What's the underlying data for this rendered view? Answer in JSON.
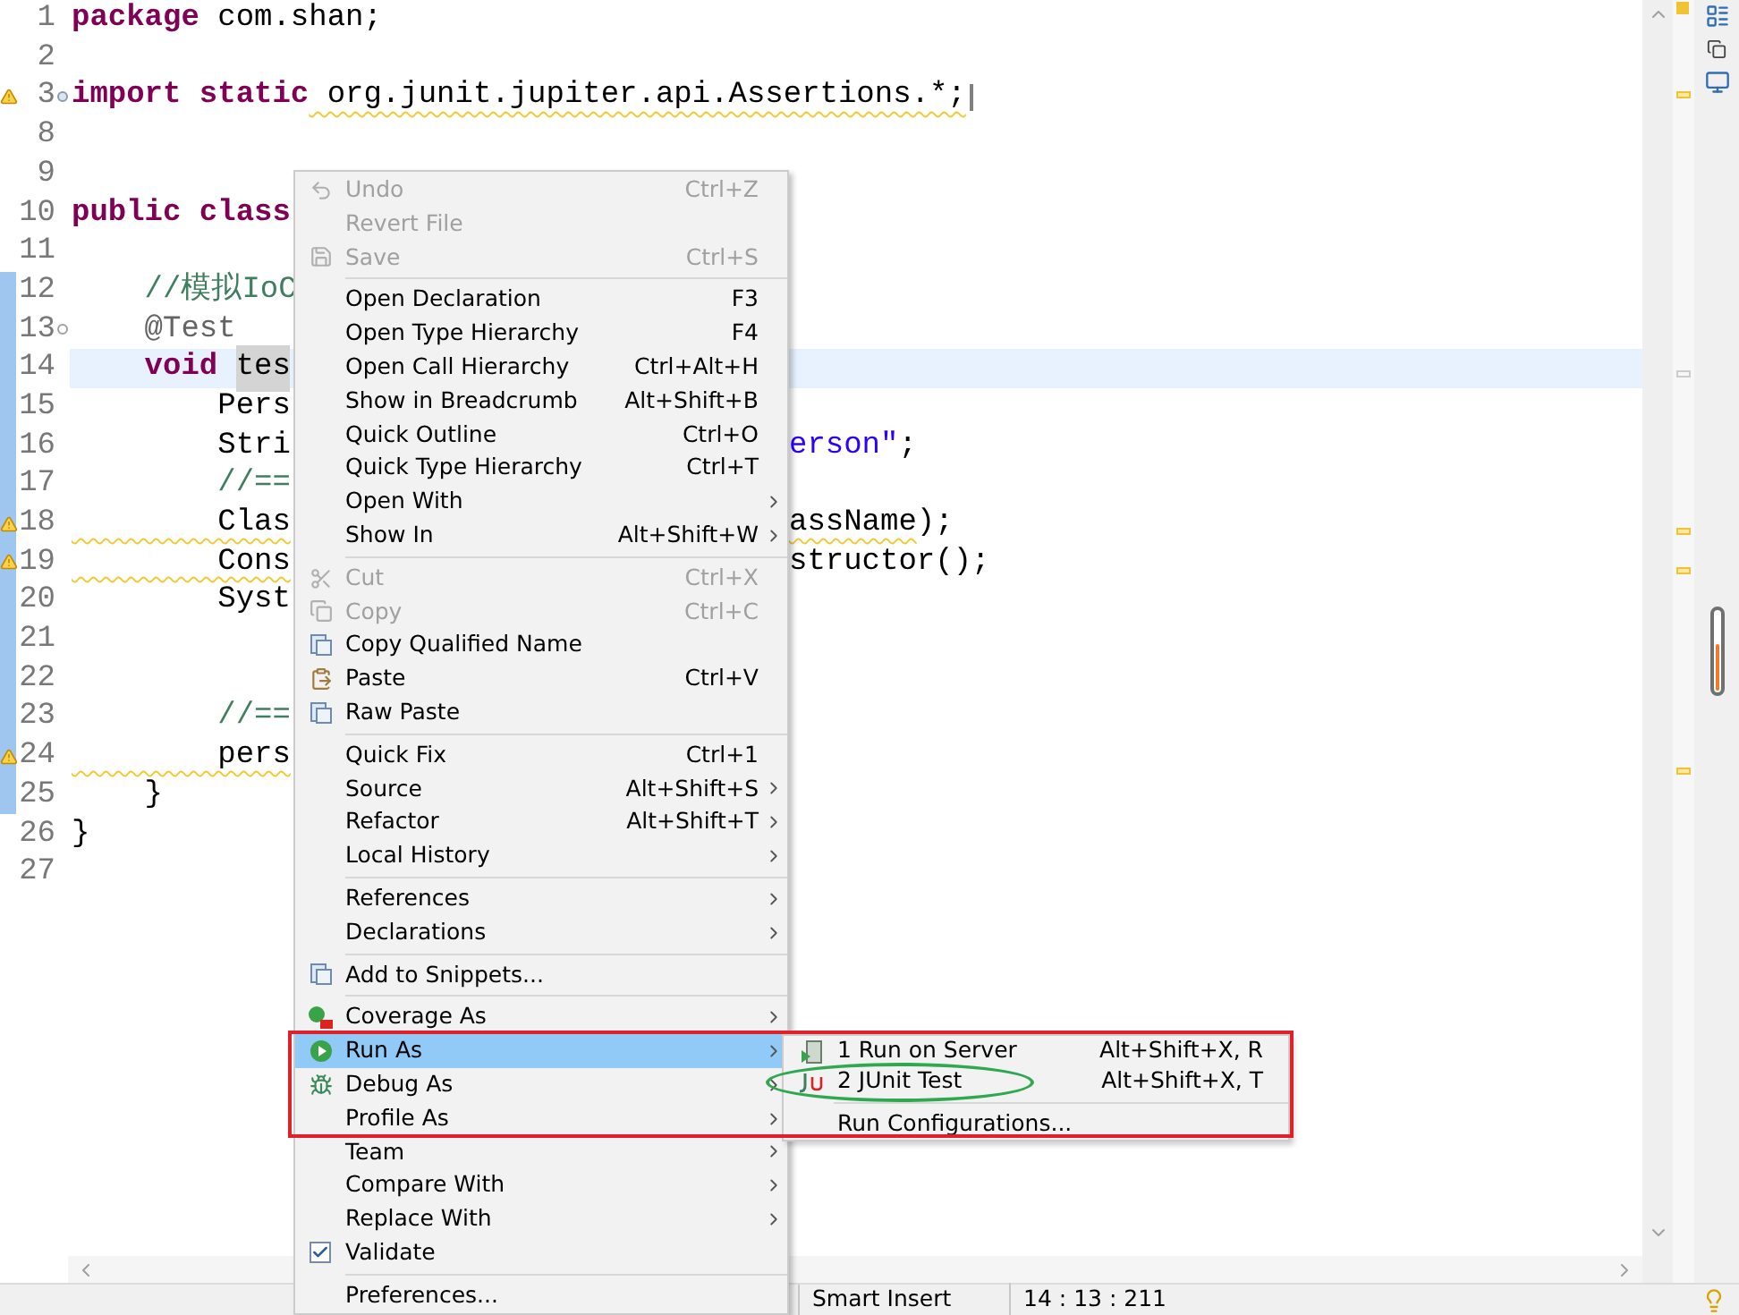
{
  "editor": {
    "lines": [
      {
        "number": "1",
        "warning": false,
        "changed": false,
        "current": false,
        "tokens": [
          {
            "kind": "keyword",
            "text": "package"
          },
          {
            "kind": "plain",
            "text": " com.shan;"
          }
        ]
      },
      {
        "number": "2",
        "warning": false,
        "changed": false,
        "current": false
      },
      {
        "number": "3",
        "warning": true,
        "changed": false,
        "current": false,
        "folded": true,
        "tokens": [
          {
            "kind": "keyword",
            "text": "import static"
          },
          {
            "kind": "flagged",
            "text": " org.junit.jupiter.api.Assertions.*;"
          }
        ],
        "folded_box": true
      },
      {
        "number": "8",
        "warning": false,
        "changed": false,
        "current": false
      },
      {
        "number": "9",
        "warning": false,
        "changed": false,
        "current": false
      },
      {
        "number": "10",
        "warning": false,
        "changed": false,
        "current": false,
        "tokens": [
          {
            "kind": "keyword",
            "text": "public class"
          }
        ]
      },
      {
        "number": "11",
        "warning": false,
        "changed": false,
        "current": false
      },
      {
        "number": "12",
        "warning": false,
        "changed": true,
        "current": false,
        "tokens": [
          {
            "kind": "comment",
            "text": "    //模拟IoC"
          }
        ]
      },
      {
        "number": "13",
        "warning": false,
        "changed": true,
        "current": false,
        "folded": false,
        "tokens": [
          {
            "kind": "annotation",
            "text": "    @Test"
          }
        ]
      },
      {
        "number": "14",
        "warning": false,
        "changed": true,
        "current": true,
        "tokens": [
          {
            "kind": "keyword",
            "text": "    void "
          },
          {
            "kind": "selection",
            "text": "tes"
          }
        ]
      },
      {
        "number": "15",
        "warning": false,
        "changed": true,
        "current": false,
        "tokens": [
          {
            "kind": "plain",
            "text": "        Pers"
          }
        ]
      },
      {
        "number": "16",
        "warning": false,
        "changed": true,
        "current": false,
        "tokens": [
          {
            "kind": "plain",
            "text": "        Stri"
          }
        ],
        "tail": [
          {
            "kind": "string",
            "text": "erson\""
          },
          {
            "kind": "plain",
            "text": ";"
          }
        ]
      },
      {
        "number": "17",
        "warning": false,
        "changed": true,
        "current": false,
        "tokens": [
          {
            "kind": "comment",
            "text": "        //=="
          }
        ]
      },
      {
        "number": "18",
        "warning": true,
        "changed": true,
        "current": false,
        "tokens": [
          {
            "kind": "flagged",
            "text": "        Clas"
          }
        ],
        "tail": [
          {
            "kind": "flagged",
            "text": "assName"
          },
          {
            "kind": "plain",
            "text": ");"
          }
        ]
      },
      {
        "number": "19",
        "warning": true,
        "changed": true,
        "current": false,
        "tokens": [
          {
            "kind": "flagged",
            "text": "        Cons"
          }
        ],
        "tail": [
          {
            "kind": "plain",
            "text": "structor();"
          }
        ]
      },
      {
        "number": "20",
        "warning": false,
        "changed": true,
        "current": false,
        "tokens": [
          {
            "kind": "plain",
            "text": "        Syst"
          }
        ]
      },
      {
        "number": "21",
        "warning": false,
        "changed": true,
        "current": false
      },
      {
        "number": "22",
        "warning": false,
        "changed": true,
        "current": false
      },
      {
        "number": "23",
        "warning": false,
        "changed": true,
        "current": false,
        "tokens": [
          {
            "kind": "comment",
            "text": "        //=="
          }
        ]
      },
      {
        "number": "24",
        "warning": true,
        "changed": true,
        "current": false,
        "tokens": [
          {
            "kind": "flagged",
            "text": "        pers"
          }
        ]
      },
      {
        "number": "25",
        "warning": false,
        "changed": true,
        "current": false,
        "tokens": [
          {
            "kind": "plain",
            "text": "    }"
          }
        ]
      },
      {
        "number": "26",
        "warning": false,
        "changed": false,
        "current": false,
        "tokens": [
          {
            "kind": "plain",
            "text": "}"
          }
        ]
      },
      {
        "number": "27",
        "warning": false,
        "changed": false,
        "current": false
      }
    ]
  },
  "context_menu": {
    "items": [
      {
        "kind": "item",
        "label": "Undo",
        "shortcut": "Ctrl+Z",
        "disabled": true,
        "submenu": false,
        "selected": false
      },
      {
        "kind": "item",
        "label": "Revert File",
        "disabled": true,
        "submenu": false,
        "selected": false
      },
      {
        "kind": "item",
        "label": "Save",
        "shortcut": "Ctrl+S",
        "disabled": true,
        "submenu": false,
        "selected": false
      },
      {
        "kind": "separator"
      },
      {
        "kind": "item",
        "label": "Open Declaration",
        "shortcut": "F3",
        "disabled": false,
        "submenu": false,
        "selected": false
      },
      {
        "kind": "item",
        "label": "Open Type Hierarchy",
        "shortcut": "F4",
        "disabled": false,
        "submenu": false,
        "selected": false
      },
      {
        "kind": "item",
        "label": "Open Call Hierarchy",
        "shortcut": "Ctrl+Alt+H",
        "disabled": false,
        "submenu": false,
        "selected": false
      },
      {
        "kind": "item",
        "label": "Show in Breadcrumb",
        "shortcut": "Alt+Shift+B",
        "disabled": false,
        "submenu": false,
        "selected": false
      },
      {
        "kind": "item",
        "label": "Quick Outline",
        "shortcut": "Ctrl+O",
        "disabled": false,
        "submenu": false,
        "selected": false
      },
      {
        "kind": "item",
        "label": "Quick Type Hierarchy",
        "shortcut": "Ctrl+T",
        "disabled": false,
        "submenu": false,
        "selected": false
      },
      {
        "kind": "item",
        "label": "Open With",
        "disabled": false,
        "submenu": true,
        "selected": false
      },
      {
        "kind": "item",
        "label": "Show In",
        "shortcut": "Alt+Shift+W",
        "disabled": false,
        "submenu": true,
        "selected": false
      },
      {
        "kind": "separator"
      },
      {
        "kind": "item",
        "label": "Cut",
        "shortcut": "Ctrl+X",
        "disabled": true,
        "submenu": false,
        "selected": false
      },
      {
        "kind": "item",
        "label": "Copy",
        "shortcut": "Ctrl+C",
        "disabled": true,
        "submenu": false,
        "selected": false
      },
      {
        "kind": "item",
        "label": "Copy Qualified Name",
        "disabled": false,
        "submenu": false,
        "selected": false
      },
      {
        "kind": "item",
        "label": "Paste",
        "shortcut": "Ctrl+V",
        "disabled": false,
        "submenu": false,
        "selected": false
      },
      {
        "kind": "item",
        "label": "Raw Paste",
        "disabled": false,
        "submenu": false,
        "selected": false
      },
      {
        "kind": "separator"
      },
      {
        "kind": "item",
        "label": "Quick Fix",
        "shortcut": "Ctrl+1",
        "disabled": false,
        "submenu": false,
        "selected": false
      },
      {
        "kind": "item",
        "label": "Source",
        "shortcut": "Alt+Shift+S",
        "disabled": false,
        "submenu": true,
        "selected": false
      },
      {
        "kind": "item",
        "label": "Refactor",
        "shortcut": "Alt+Shift+T",
        "disabled": false,
        "submenu": true,
        "selected": false
      },
      {
        "kind": "item",
        "label": "Local History",
        "disabled": false,
        "submenu": true,
        "selected": false
      },
      {
        "kind": "separator"
      },
      {
        "kind": "item",
        "label": "References",
        "disabled": false,
        "submenu": true,
        "selected": false
      },
      {
        "kind": "item",
        "label": "Declarations",
        "disabled": false,
        "submenu": true,
        "selected": false
      },
      {
        "kind": "separator"
      },
      {
        "kind": "item",
        "label": "Add to Snippets...",
        "disabled": false,
        "submenu": false,
        "selected": false
      },
      {
        "kind": "separator"
      },
      {
        "kind": "item",
        "label": "Coverage As",
        "disabled": false,
        "submenu": true,
        "selected": false
      },
      {
        "kind": "item",
        "label": "Run As",
        "disabled": false,
        "submenu": true,
        "selected": true
      },
      {
        "kind": "item",
        "label": "Debug As",
        "disabled": false,
        "submenu": true,
        "selected": false
      },
      {
        "kind": "item",
        "label": "Profile As",
        "disabled": false,
        "submenu": true,
        "selected": false
      },
      {
        "kind": "item",
        "label": "Team",
        "disabled": false,
        "submenu": true,
        "selected": false
      },
      {
        "kind": "item",
        "label": "Compare With",
        "disabled": false,
        "submenu": true,
        "selected": false
      },
      {
        "kind": "item",
        "label": "Replace With",
        "disabled": false,
        "submenu": true,
        "selected": false
      },
      {
        "kind": "check",
        "label": "Validate",
        "checked": true,
        "disabled": false,
        "submenu": false,
        "selected": false
      },
      {
        "kind": "separator"
      },
      {
        "kind": "item",
        "label": "Preferences...",
        "disabled": false,
        "submenu": false,
        "selected": false
      }
    ]
  },
  "submenu": {
    "items": [
      {
        "kind": "item",
        "label": "1 Run on Server",
        "shortcut": "Alt+Shift+X, R"
      },
      {
        "kind": "item",
        "label": "2 JUnit Test",
        "shortcut": "Alt+Shift+X, T"
      },
      {
        "kind": "separator"
      },
      {
        "kind": "item",
        "label": "Run Configurations..."
      }
    ]
  },
  "status_bar": {
    "insert_mode": "Smart Insert",
    "position": "14 : 13 : 211"
  }
}
